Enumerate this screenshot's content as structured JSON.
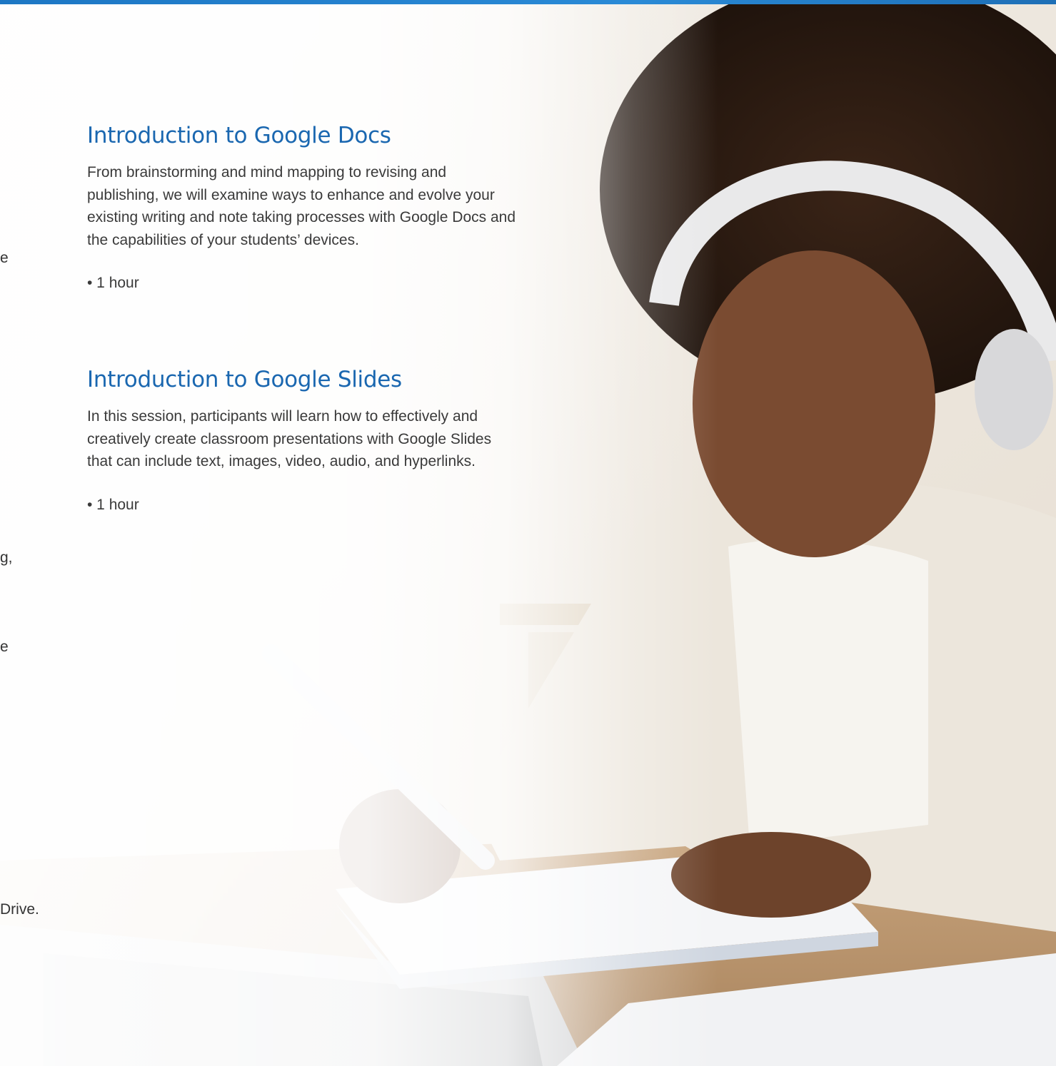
{
  "sessions": [
    {
      "title": "Introduction to Google Docs",
      "description": "From brainstorming and mind mapping to revising and publishing, we will examine ways to enhance and evolve your existing writing and note taking processes with Google Docs and the capabilities of your students’ devices.",
      "duration": "• 1 hour"
    },
    {
      "title": "Introduction to Google Slides",
      "description": "In this session, participants will learn how to effectively and creatively create classroom presentations with Google Slides that can include text, images, video, audio, and hyperlinks.",
      "duration": "• 1 hour"
    }
  ],
  "left_edge_fragments": [
    "e",
    "g,",
    "e",
    "Drive."
  ],
  "colors": {
    "accent_bar": "#1d77c4",
    "heading": "#1a67b0",
    "body_text": "#3a3a3a"
  }
}
